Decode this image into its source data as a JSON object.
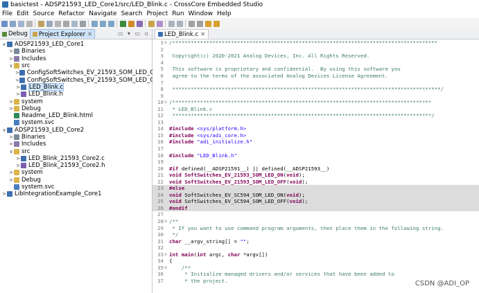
{
  "window": {
    "title": "basictest - ADSP21593_LED_Core1/src/LED_Blink.c - CrossCore Embedded Studio"
  },
  "menu": [
    "File",
    "Edit",
    "Source",
    "Refactor",
    "Navigate",
    "Search",
    "Project",
    "Run",
    "Window",
    "Help"
  ],
  "left_tabs": {
    "debug": "Debug",
    "explorer": "Project Explorer"
  },
  "tree": [
    {
      "indent": 0,
      "twisty": "∨",
      "icon": "project",
      "label": "ADSP21593_LED_Core1"
    },
    {
      "indent": 1,
      "twisty": ">",
      "icon": "binaries",
      "label": "Binaries"
    },
    {
      "indent": 1,
      "twisty": ">",
      "icon": "includes",
      "label": "Includes"
    },
    {
      "indent": 1,
      "twisty": "∨",
      "icon": "folder",
      "label": "src"
    },
    {
      "indent": 2,
      "twisty": ">",
      "icon": "cfile",
      "label": "ConfigSoftSwitches_EV_21593_SOM_LED_OFF.c"
    },
    {
      "indent": 2,
      "twisty": ">",
      "icon": "cfile",
      "label": "ConfigSoftSwitches_EV_21593_SOM_LED_ON.c"
    },
    {
      "indent": 2,
      "twisty": ">",
      "icon": "cfile",
      "label": "LED_Blink.c",
      "selected": true
    },
    {
      "indent": 2,
      "twisty": ">",
      "icon": "hfile",
      "label": "LED_Blink.h"
    },
    {
      "indent": 1,
      "twisty": ">",
      "icon": "folder",
      "label": "system"
    },
    {
      "indent": 1,
      "twisty": ">",
      "icon": "folder",
      "label": "Debug"
    },
    {
      "indent": 1,
      "twisty": "",
      "icon": "html",
      "label": "Readme_LED_Blink.html"
    },
    {
      "indent": 1,
      "twisty": "",
      "icon": "svc",
      "label": "system.svc"
    },
    {
      "indent": 0,
      "twisty": "∨",
      "icon": "project",
      "label": "ADSP21593_LED_Core2"
    },
    {
      "indent": 1,
      "twisty": ">",
      "icon": "binaries",
      "label": "Binaries"
    },
    {
      "indent": 1,
      "twisty": ">",
      "icon": "includes",
      "label": "Includes"
    },
    {
      "indent": 1,
      "twisty": "∨",
      "icon": "folder",
      "label": "src"
    },
    {
      "indent": 2,
      "twisty": ">",
      "icon": "cfile",
      "label": "LED_Blink_21593_Core2.c"
    },
    {
      "indent": 2,
      "twisty": ">",
      "icon": "hfile",
      "label": "LED_Blink_21593_Core2.h"
    },
    {
      "indent": 1,
      "twisty": ">",
      "icon": "folder",
      "label": "system"
    },
    {
      "indent": 1,
      "twisty": ">",
      "icon": "folder",
      "label": "Debug"
    },
    {
      "indent": 1,
      "twisty": "",
      "icon": "svc",
      "label": "system.svc"
    },
    {
      "indent": 0,
      "twisty": ">",
      "icon": "project",
      "label": "LibIntegrationExample_Core1"
    }
  ],
  "editor": {
    "tab": "LED_Blink.c",
    "lines": [
      {
        "n": "1",
        "m": "⊖",
        "hl": false,
        "parts": [
          [
            "green",
            "/**************************************************************************************"
          ]
        ]
      },
      {
        "n": "2",
        "m": "",
        "hl": false,
        "parts": [
          [
            "green",
            ""
          ]
        ]
      },
      {
        "n": "3",
        "m": "",
        "hl": false,
        "parts": [
          [
            "green",
            " Copyright(c) 2020-2021 Analog Devices, Inc. All Rights Reserved."
          ]
        ]
      },
      {
        "n": "4",
        "m": "",
        "hl": false,
        "parts": [
          [
            "green",
            ""
          ]
        ]
      },
      {
        "n": "5",
        "m": "",
        "hl": false,
        "parts": [
          [
            "green",
            " This software is proprietary and confidential.  By using this software you"
          ]
        ]
      },
      {
        "n": "6",
        "m": "",
        "hl": false,
        "parts": [
          [
            "green",
            " agree to the terms of the associated Analog Devices License Agreement."
          ]
        ]
      },
      {
        "n": "7",
        "m": "",
        "hl": false,
        "parts": [
          [
            "green",
            ""
          ]
        ]
      },
      {
        "n": "8",
        "m": "",
        "hl": false,
        "parts": [
          [
            "green",
            " ***************************************************************************************/"
          ]
        ]
      },
      {
        "n": "9",
        "m": "",
        "hl": false,
        "parts": [
          [
            "green",
            ""
          ]
        ]
      },
      {
        "n": "10",
        "m": "⊖",
        "hl": false,
        "parts": [
          [
            "green",
            "/************************************************************************************"
          ]
        ]
      },
      {
        "n": "11",
        "m": "",
        "hl": false,
        "parts": [
          [
            "green",
            " * LED_Blink.c"
          ]
        ]
      },
      {
        "n": "12",
        "m": "",
        "hl": false,
        "parts": [
          [
            "green",
            " ************************************************************************************/"
          ]
        ]
      },
      {
        "n": "13",
        "m": "",
        "hl": false,
        "parts": [
          [
            "plain",
            ""
          ]
        ]
      },
      {
        "n": "14",
        "m": "",
        "hl": false,
        "parts": [
          [
            "pp",
            "#include"
          ],
          [
            "plain",
            " "
          ],
          [
            "str",
            "<sys/platform.h>"
          ]
        ]
      },
      {
        "n": "15",
        "m": "",
        "hl": false,
        "parts": [
          [
            "pp",
            "#include"
          ],
          [
            "plain",
            " "
          ],
          [
            "str",
            "<sys/adi_core.h>"
          ]
        ]
      },
      {
        "n": "16",
        "m": "",
        "hl": false,
        "parts": [
          [
            "pp",
            "#include"
          ],
          [
            "plain",
            " "
          ],
          [
            "str",
            "\"adi_initialize.h\""
          ]
        ]
      },
      {
        "n": "17",
        "m": "",
        "hl": false,
        "parts": [
          [
            "plain",
            ""
          ]
        ]
      },
      {
        "n": "18",
        "m": "",
        "hl": false,
        "parts": [
          [
            "pp",
            "#include"
          ],
          [
            "plain",
            " "
          ],
          [
            "str",
            "\"LED_Blink.h\""
          ]
        ]
      },
      {
        "n": "19",
        "m": "",
        "hl": false,
        "parts": [
          [
            "plain",
            ""
          ]
        ]
      },
      {
        "n": "20",
        "m": "",
        "hl": false,
        "parts": [
          [
            "pp",
            "#if"
          ],
          [
            "plain",
            " defined(__ADSP21591__) || defined(__ADSP21593__)"
          ]
        ]
      },
      {
        "n": "21",
        "m": "",
        "hl": false,
        "parts": [
          [
            "kw",
            "void"
          ],
          [
            "plain",
            " "
          ],
          [
            "kw",
            "SoftSwitches_EV_21593_SOM_LED_ON"
          ],
          [
            "plain",
            "("
          ],
          [
            "kw",
            "void"
          ],
          [
            "plain",
            ");"
          ]
        ]
      },
      {
        "n": "22",
        "m": "",
        "hl": false,
        "parts": [
          [
            "kw",
            "void"
          ],
          [
            "plain",
            " "
          ],
          [
            "kw",
            "SoftSwitches_EV_21593_SOM_LED_OFF"
          ],
          [
            "plain",
            "("
          ],
          [
            "kw",
            "void"
          ],
          [
            "plain",
            ");"
          ]
        ]
      },
      {
        "n": "23",
        "m": "",
        "hl": true,
        "parts": [
          [
            "pp",
            "#else"
          ]
        ]
      },
      {
        "n": "24",
        "m": "",
        "hl": true,
        "parts": [
          [
            "kw",
            "void"
          ],
          [
            "plain",
            " SoftSwitches_EV_SC594_SOM_LED_ON("
          ],
          [
            "kw",
            "void"
          ],
          [
            "plain",
            ");"
          ]
        ]
      },
      {
        "n": "25",
        "m": "",
        "hl": true,
        "parts": [
          [
            "kw",
            "void"
          ],
          [
            "plain",
            " SoftSwitches_EV_SC594_SOM_LED_OFF("
          ],
          [
            "kw",
            "void"
          ],
          [
            "plain",
            ");"
          ]
        ]
      },
      {
        "n": "26",
        "m": "",
        "hl": true,
        "parts": [
          [
            "pp",
            "#endif"
          ]
        ]
      },
      {
        "n": "27",
        "m": "",
        "hl": false,
        "parts": [
          [
            "plain",
            ""
          ]
        ]
      },
      {
        "n": "28",
        "m": "⊖",
        "hl": false,
        "parts": [
          [
            "green",
            "/**"
          ]
        ]
      },
      {
        "n": "29",
        "m": "",
        "hl": false,
        "parts": [
          [
            "green",
            " * If you want to use command program arguments, then place them in the following string."
          ]
        ]
      },
      {
        "n": "30",
        "m": "",
        "hl": false,
        "parts": [
          [
            "green",
            " */"
          ]
        ]
      },
      {
        "n": "31",
        "m": "",
        "hl": false,
        "parts": [
          [
            "kw",
            "char"
          ],
          [
            "plain",
            " __argv_string[] = "
          ],
          [
            "str",
            "\"\""
          ],
          [
            "plain",
            ";"
          ]
        ]
      },
      {
        "n": "32",
        "m": "",
        "hl": false,
        "parts": [
          [
            "plain",
            ""
          ]
        ]
      },
      {
        "n": "33",
        "m": "⊖",
        "hl": false,
        "parts": [
          [
            "kw",
            "int"
          ],
          [
            "plain",
            " "
          ],
          [
            "kw",
            "main"
          ],
          [
            "plain",
            "("
          ],
          [
            "kw",
            "int"
          ],
          [
            "plain",
            " argc, "
          ],
          [
            "kw",
            "char"
          ],
          [
            "plain",
            " *argv[])"
          ]
        ]
      },
      {
        "n": "34",
        "m": "",
        "hl": false,
        "parts": [
          [
            "plain",
            "{"
          ]
        ]
      },
      {
        "n": "35",
        "m": "⊖",
        "hl": false,
        "parts": [
          [
            "green",
            "    /**"
          ]
        ]
      },
      {
        "n": "36",
        "m": "",
        "hl": false,
        "parts": [
          [
            "green",
            "     * Initialize managed drivers and/or services that have been added to"
          ]
        ]
      },
      {
        "n": "37",
        "m": "",
        "hl": false,
        "parts": [
          [
            "green",
            "     * the project."
          ]
        ]
      }
    ]
  },
  "watermark": "CSDN @ADI_OP",
  "colors": {
    "comment": "#3f7f5f",
    "keyword": "#7f0055",
    "string": "#2a00ff",
    "selection": "#cfe5fb",
    "inactive_block": "#dcdcdc"
  }
}
